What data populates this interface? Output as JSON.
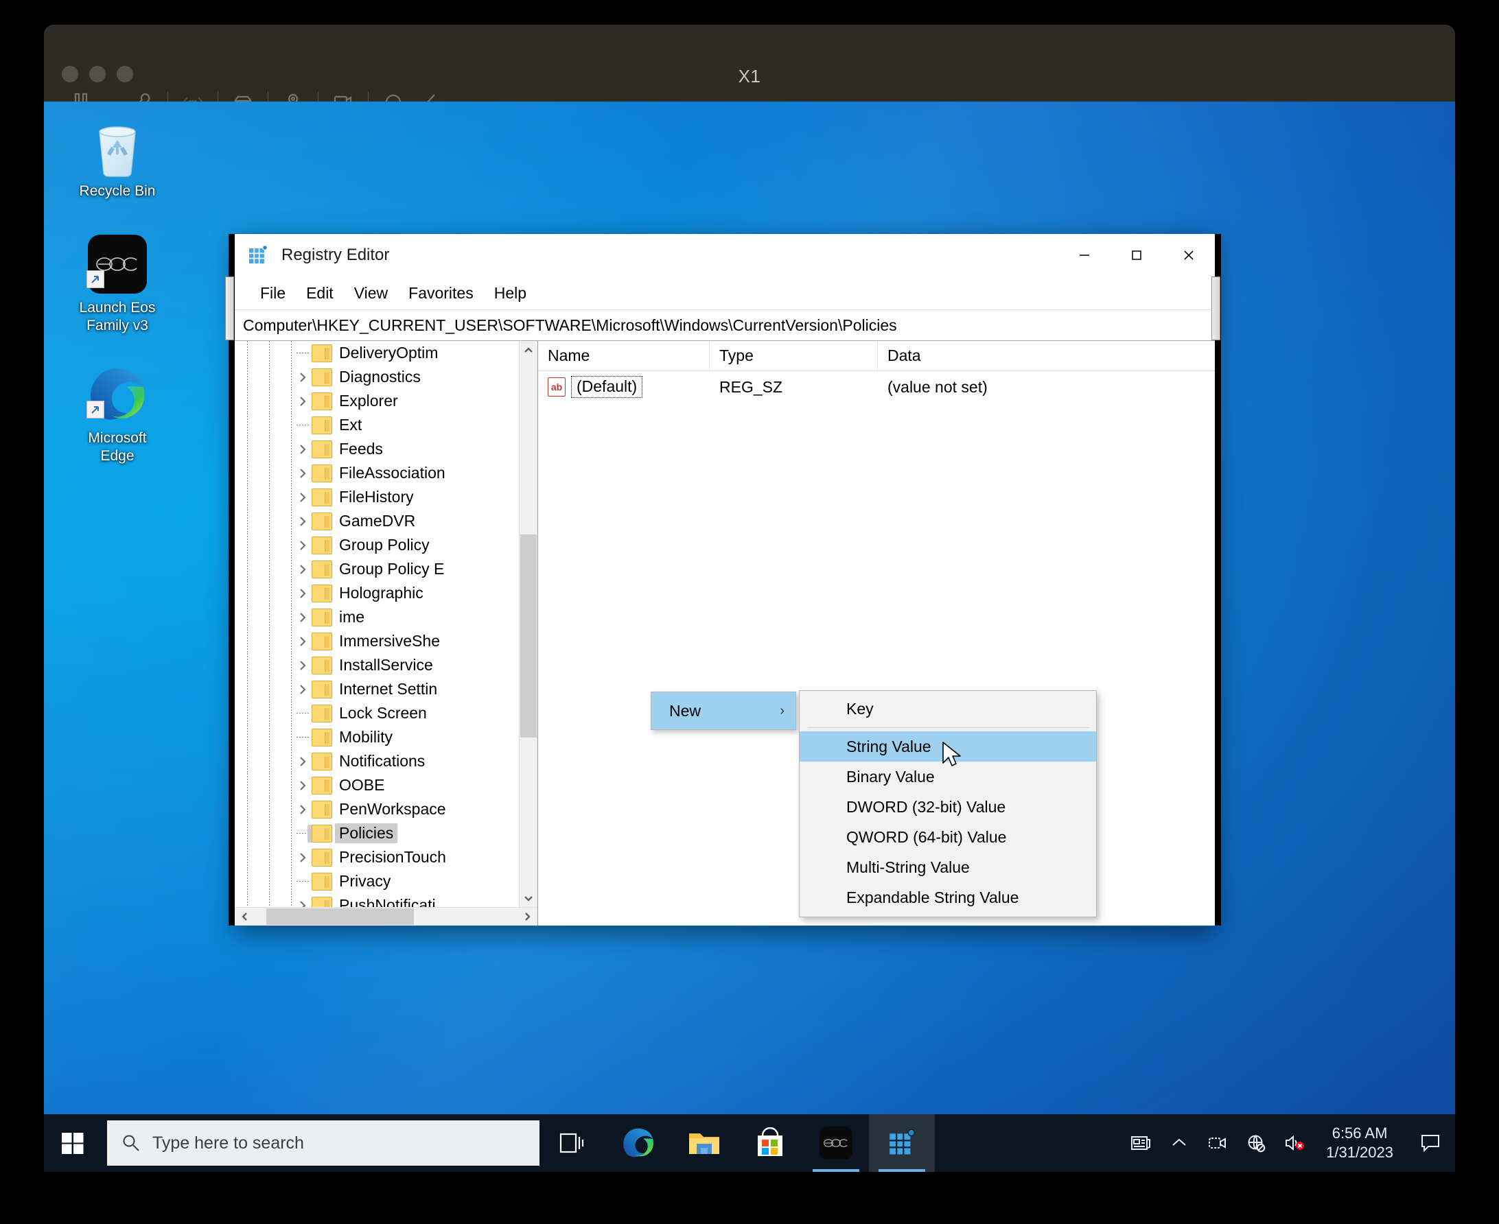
{
  "vm": {
    "title": "X1",
    "toolbar_icons": [
      "pause-icon",
      "wrench-icon",
      "network-icon",
      "disk-icon",
      "usb-icon",
      "camera-icon",
      "headphones-icon",
      "collapse-icon"
    ]
  },
  "desktop": {
    "icons": [
      {
        "name": "recycle-bin",
        "label": "Recycle Bin"
      },
      {
        "name": "launch-eos-family-v3",
        "label": "Launch Eos\nFamily v3",
        "label_line1": "Launch Eos",
        "label_line2": "Family v3"
      },
      {
        "name": "microsoft-edge",
        "label": "Microsoft\nEdge",
        "label_line1": "Microsoft",
        "label_line2": "Edge"
      }
    ]
  },
  "regedit": {
    "title": "Registry Editor",
    "menus": [
      "File",
      "Edit",
      "View",
      "Favorites",
      "Help"
    ],
    "address": "Computer\\HKEY_CURRENT_USER\\SOFTWARE\\Microsoft\\Windows\\CurrentVersion\\Policies",
    "window_buttons": [
      "minimize",
      "maximize",
      "close"
    ],
    "tree": [
      {
        "label": "DeliveryOptim",
        "expandable": false,
        "selected": false
      },
      {
        "label": "Diagnostics",
        "expandable": true,
        "selected": false
      },
      {
        "label": "Explorer",
        "expandable": true,
        "selected": false
      },
      {
        "label": "Ext",
        "expandable": false,
        "selected": false
      },
      {
        "label": "Feeds",
        "expandable": true,
        "selected": false
      },
      {
        "label": "FileAssociation",
        "expandable": true,
        "selected": false
      },
      {
        "label": "FileHistory",
        "expandable": true,
        "selected": false
      },
      {
        "label": "GameDVR",
        "expandable": true,
        "selected": false
      },
      {
        "label": "Group Policy",
        "expandable": true,
        "selected": false
      },
      {
        "label": "Group Policy E",
        "expandable": true,
        "selected": false
      },
      {
        "label": "Holographic",
        "expandable": true,
        "selected": false
      },
      {
        "label": "ime",
        "expandable": true,
        "selected": false
      },
      {
        "label": "ImmersiveShe",
        "expandable": true,
        "selected": false
      },
      {
        "label": "InstallService",
        "expandable": true,
        "selected": false
      },
      {
        "label": "Internet Settin",
        "expandable": true,
        "selected": false
      },
      {
        "label": "Lock Screen",
        "expandable": false,
        "selected": false
      },
      {
        "label": "Mobility",
        "expandable": false,
        "selected": false
      },
      {
        "label": "Notifications",
        "expandable": true,
        "selected": false
      },
      {
        "label": "OOBE",
        "expandable": true,
        "selected": false
      },
      {
        "label": "PenWorkspace",
        "expandable": true,
        "selected": false
      },
      {
        "label": "Policies",
        "expandable": false,
        "selected": true
      },
      {
        "label": "PrecisionTouch",
        "expandable": true,
        "selected": false
      },
      {
        "label": "Privacy",
        "expandable": false,
        "selected": false
      },
      {
        "label": "PushNotificati",
        "expandable": true,
        "selected": false
      }
    ],
    "list": {
      "columns": [
        "Name",
        "Type",
        "Data"
      ],
      "rows": [
        {
          "name": "(Default)",
          "type": "REG_SZ",
          "data": "(value not set)",
          "icon": "ab-string-icon"
        }
      ]
    }
  },
  "context_menu": {
    "parent_label": "New",
    "items": [
      {
        "label": "Key",
        "highlighted": false
      },
      {
        "label": "String Value",
        "highlighted": true
      },
      {
        "label": "Binary Value",
        "highlighted": false
      },
      {
        "label": "DWORD (32-bit) Value",
        "highlighted": false
      },
      {
        "label": "QWORD (64-bit) Value",
        "highlighted": false
      },
      {
        "label": "Multi-String Value",
        "highlighted": false
      },
      {
        "label": "Expandable String Value",
        "highlighted": false
      }
    ],
    "highlight_color": "#9ed0f0"
  },
  "taskbar": {
    "search_placeholder": "Type here to search",
    "apps": [
      {
        "name": "task-view-icon",
        "running": false,
        "active": false
      },
      {
        "name": "microsoft-edge-icon",
        "running": false,
        "active": false
      },
      {
        "name": "file-explorer-icon",
        "running": false,
        "active": false
      },
      {
        "name": "microsoft-store-icon",
        "running": false,
        "active": false
      },
      {
        "name": "eos-icon",
        "running": true,
        "active": false
      },
      {
        "name": "registry-editor-icon",
        "running": true,
        "active": true
      }
    ],
    "tray": [
      "news-and-interests-icon",
      "show-hidden-icons-icon",
      "meet-now-icon",
      "network-disconnected-icon",
      "volume-muted-icon"
    ],
    "time": "6:56 AM",
    "date": "1/31/2023"
  }
}
